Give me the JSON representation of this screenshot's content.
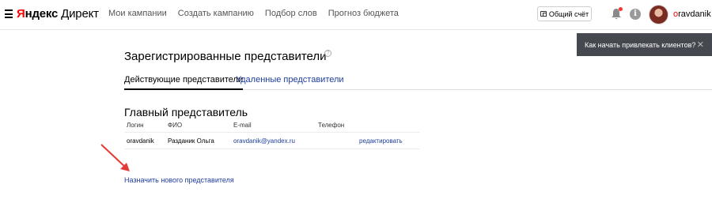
{
  "header": {
    "logo_brand_first": "Я",
    "logo_brand_rest": "ндекс",
    "logo_product": "Директ",
    "nav": [
      "Мои кампании",
      "Создать кампанию",
      "Подбор слов",
      "Прогноз бюджета"
    ],
    "account_button": "Общий счёт",
    "username_first": "o",
    "username_rest": "ravdanik",
    "info_symbol": "i",
    "icons": {
      "menu": "burger-menu-icon",
      "wallet": "wallet-icon",
      "bell": "bell-icon",
      "info": "info-icon"
    },
    "notification_color": "#ff3333"
  },
  "toast": {
    "text": "Как начать привлекать клиентов?",
    "close": "✕"
  },
  "page": {
    "title": "Зарегистрированные представители",
    "help": "?",
    "tabs": [
      {
        "label": "Действующие представители",
        "active": true
      },
      {
        "label": "Удаленные представители",
        "active": false
      }
    ]
  },
  "main_rep": {
    "heading": "Главный представитель",
    "columns": [
      "Логин",
      "ФИО",
      "E-mail",
      "Телефон"
    ],
    "rows": [
      {
        "login": "oravdanik",
        "name": "Разданик Ольга",
        "email": "oravdanik@yandex.ru",
        "phone": "",
        "action": "редактировать"
      }
    ]
  },
  "assign_link": "Назначить нового представителя",
  "colors": {
    "link": "#1e3d9c",
    "arrow": "#e53935",
    "toast_bg": "#45494f"
  }
}
